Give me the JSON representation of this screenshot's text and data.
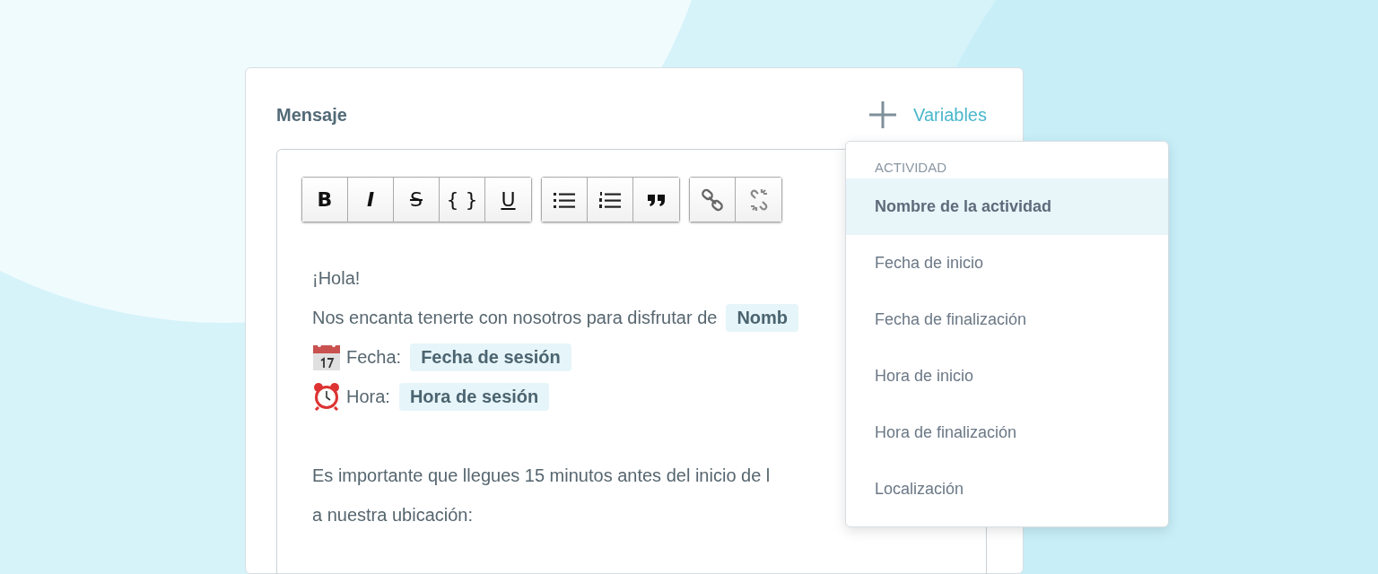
{
  "card": {
    "title": "Mensaje",
    "variables_button": {
      "label": "Variables"
    }
  },
  "toolbar": {
    "groups": [
      [
        {
          "kind": "bold",
          "label": "B"
        },
        {
          "kind": "italic",
          "label": "I"
        },
        {
          "kind": "strike",
          "label": "S"
        },
        {
          "kind": "code",
          "label": "{ }"
        },
        {
          "kind": "underline",
          "label": "U"
        }
      ],
      [
        {
          "kind": "bullet-list"
        },
        {
          "kind": "numbered-list"
        },
        {
          "kind": "quote"
        }
      ],
      [
        {
          "kind": "link"
        },
        {
          "kind": "unlink"
        }
      ]
    ]
  },
  "body": {
    "lines": [
      {
        "kind": "text",
        "text": "¡Hola!"
      },
      {
        "kind": "text",
        "text": "Nos encanta tenerte con nosotros para disfrutar de",
        "chip": "Nomb"
      },
      {
        "kind": "calendar",
        "text": "Fecha:",
        "chip": "Fecha de sesión"
      },
      {
        "kind": "alarm",
        "text": "Hora:",
        "chip": "Hora de sesión"
      },
      {
        "kind": "blank"
      },
      {
        "kind": "text",
        "text": "Es importante que llegues 15 minutos antes del inicio de l"
      },
      {
        "kind": "text",
        "text": "a nuestra ubicación:"
      }
    ]
  },
  "dropdown": {
    "section": "ACTIVIDAD",
    "items": [
      {
        "label": "Nombre de la actividad",
        "selected": true
      },
      {
        "label": "Fecha de inicio",
        "selected": false
      },
      {
        "label": "Fecha de finalización",
        "selected": false
      },
      {
        "label": "Hora de inicio",
        "selected": false
      },
      {
        "label": "Hora de finalización",
        "selected": false
      },
      {
        "label": "Localización",
        "selected": false
      }
    ]
  }
}
